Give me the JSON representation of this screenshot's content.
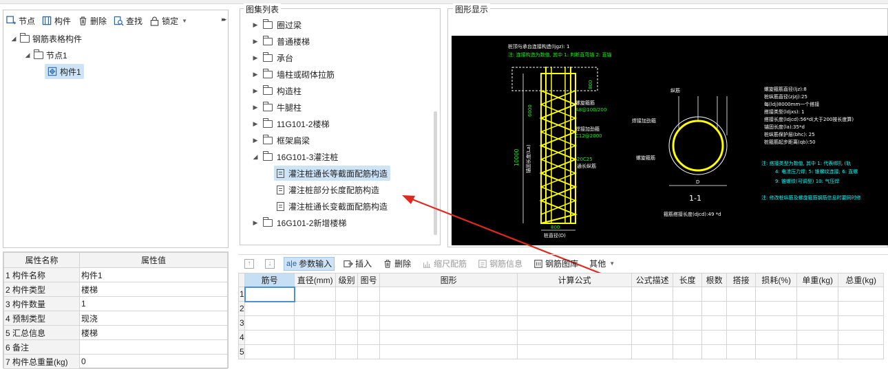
{
  "left_toolbar": {
    "node_label": "节点",
    "component_label": "构件",
    "delete_label": "删除",
    "find_label": "查找",
    "lock_label": "锁定"
  },
  "tree": {
    "root": "钢筋表格构件",
    "node": "节点1",
    "component": "构件1"
  },
  "properties": {
    "headers": [
      "属性名称",
      "属性值"
    ],
    "rows": [
      {
        "name": "1 构件名称",
        "value": "构件1"
      },
      {
        "name": "2 构件类型",
        "value": "楼梯"
      },
      {
        "name": "3 构件数量",
        "value": "1"
      },
      {
        "name": "4 预制类型",
        "value": "现浇"
      },
      {
        "name": "5 汇总信息",
        "value": "楼梯"
      },
      {
        "name": "6 备注",
        "value": ""
      },
      {
        "name": "7 构件总重量(kg)",
        "value": "0"
      }
    ]
  },
  "atlas": {
    "title": "图集列表",
    "categories": [
      "圈过梁",
      "普通楼梯",
      "承台",
      "墙柱或砌体拉筋",
      "构造柱",
      "牛腿柱",
      "11G101-2楼梯",
      "框架扁梁"
    ],
    "expanded": "16G101-3灌注桩",
    "items": [
      "灌注桩通长等截面配筋构造",
      "灌注桩部分长度配筋构造",
      "灌注桩通长变截面配筋构造"
    ],
    "after": "16G101-2新增楼梯"
  },
  "graphic": {
    "title": "图形显示",
    "lines_top": [
      "桩顶与承台连接构造(ljgz): 1",
      "注: 连接构造为数值, 其中 1: 判断直弯锚    2: 直锚"
    ],
    "labels": {
      "length_dim": "10000",
      "anchor": "锚固长度(La)",
      "spiral_label": "螺旋箍筋",
      "spiral_spec": "A8@100/200",
      "stiffener_label": "焊接加劲箍",
      "stiffener_spec": "C12@2000",
      "main_spec": "20C25",
      "main_label": "通长纵筋",
      "pile_dia": "桩直径(D)",
      "dim_800": "800",
      "dim_600": "6000",
      "cover": "桩顶纵筋保护层",
      "top_800": "800",
      "sec_main": "纵筋",
      "sec_stiff": "焊接加劲箍",
      "sec_spiral": "螺旋箍筋",
      "sec_d": "D",
      "sec_title": "1-1",
      "splice": "箍筋搭接长度(djcd):49 *d"
    },
    "params": [
      "螺旋箍筋直径(ljz):8",
      "桩纵筋直径(zjzj):25",
      "每(ldj)8000mm一个搭接",
      "搭接类型(ldjxs): 1",
      "搭接长度(ldjcd):56*d(大于200按长度算)",
      "锚固长度(la):35*d",
      "桩纵筋保护层(bhc): 25",
      "桩箍筋起步距离(qb):50"
    ],
    "notes": [
      "注: 搭接类型为数值, 其中 1: 代表绑扎 (轨",
      "4: 电渣压力焊; 5: 锥螺纹连接; 6: 直螺",
      "9: 锥螺纹(可调型) 10: 气压焊",
      "注: 修改桩纵筋及螺旋箍筋钢筋信息时要同时修"
    ],
    "colors": {
      "bg": "#000000",
      "rebar": "#ffff00",
      "line": "#ffffff",
      "text": "#ffffff",
      "hint": "#00ff00",
      "cyan": "#00ffff"
    }
  },
  "grid_toolbar": {
    "param_input": "参数输入",
    "insert": "插入",
    "delete": "删除",
    "scale": "缩尺配筋",
    "rebar_info": "钢筋信息",
    "rebar_lib": "钢筋图库",
    "other": "其他"
  },
  "grid": {
    "headers": [
      "筋号",
      "直径(mm)",
      "级别",
      "图号",
      "图形",
      "计算公式",
      "公式描述",
      "长度",
      "根数",
      "搭接",
      "损耗(%)",
      "单重(kg)",
      "总重(kg)"
    ],
    "row_numbers": [
      "1",
      "2",
      "3",
      "4",
      "5"
    ]
  }
}
